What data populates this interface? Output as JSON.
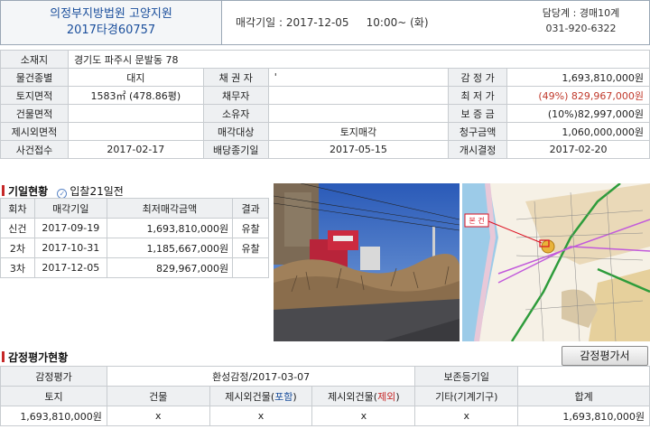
{
  "header": {
    "court": "의정부지방법원 고양지원",
    "case_no": "2017타경60757",
    "sale_date_label": "매각기일 : 2017-12-05",
    "sale_time": "10:00~ (화)",
    "manager": "담당계 : 경매10계",
    "phone": "031-920-6322"
  },
  "info": {
    "address_label": "소재지",
    "address": "경기도 파주시 문발동 78",
    "type_label": "물건종별",
    "type": "대지",
    "creditor_label": "채 권 자",
    "creditor": "'",
    "appraisal_label": "감 정 가",
    "appraisal": "1,693,810,000원",
    "land_area_label": "토지면적",
    "land_area": "1583㎡ (478.86평)",
    "debtor_label": "채무자",
    "debtor": "",
    "min_price_label": "최 저 가",
    "min_price": "(49%) 829,967,000원",
    "bldg_area_label": "건물면적",
    "bldg_area": "",
    "owner_label": "소유자",
    "owner": "",
    "deposit_label": "보 증 금",
    "deposit": "(10%)82,997,000원",
    "excl_area_label": "제시외면적",
    "excl_area": "",
    "target_label": "매각대상",
    "target": "토지매각",
    "claim_label": "청구금액",
    "claim": "1,060,000,000원",
    "filed_label": "사건접수",
    "filed": "2017-02-17",
    "dividend_label": "배당종기일",
    "dividend": "2017-05-15",
    "start_label": "개시결정",
    "start": "2017-02-20"
  },
  "history": {
    "title": "기일현황",
    "tag": "입찰21일전",
    "headers": [
      "회차",
      "매각기일",
      "최저매각금액",
      "결과"
    ],
    "rows": [
      {
        "round": "신건",
        "date": "2017-09-19",
        "price": "1,693,810,000원",
        "result": "유찰"
      },
      {
        "round": "2차",
        "date": "2017-10-31",
        "price": "1,185,667,000원",
        "result": "유찰"
      },
      {
        "round": "3차",
        "date": "2017-12-05",
        "price": "829,967,000원",
        "result": ""
      }
    ]
  },
  "map": {
    "label": "본 건"
  },
  "appraisal_section": {
    "title": "감정평가현황",
    "button": "감정평가서",
    "row1": {
      "label": "감정평가",
      "value": "환성감정/2017-03-07",
      "right_label": "보존등기일",
      "right_value": ""
    },
    "headers": [
      "토지",
      "건물",
      "제시외건물(포함)",
      "제시외건물(제외)",
      "기타(기계기구)",
      "합계"
    ],
    "header_parts": {
      "incl_pre": "제시외건물(",
      "incl_mid": "포함",
      "incl_post": ")",
      "excl_pre": "제시외건물(",
      "excl_mid": "제외",
      "excl_post": ")"
    },
    "values": [
      "1,693,810,000원",
      "x",
      "x",
      "x",
      "x",
      "1,693,810,000원"
    ]
  },
  "colors": {
    "court_blue": "#1b4f9c",
    "accent_red": "#c62828",
    "label_bg": "#eef0f2"
  }
}
